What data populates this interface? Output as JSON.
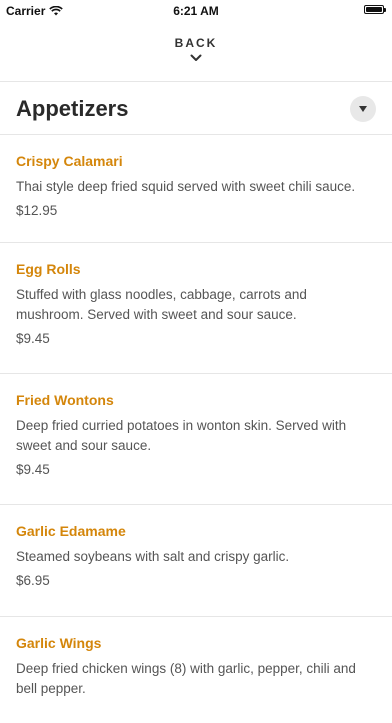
{
  "status_bar": {
    "carrier": "Carrier",
    "time": "6:21 AM",
    "wifi_icon": "wifi-icon",
    "battery_icon": "battery-icon"
  },
  "nav": {
    "back_label": "BACK",
    "chevron_icon": "chevron-down-icon"
  },
  "section": {
    "title": "Appetizers",
    "toggle_icon": "caret-down-icon"
  },
  "colors": {
    "item_name": "#d4860b",
    "text": "#555555",
    "divider": "#e6e6e6"
  },
  "items": [
    {
      "name": "Crispy Calamari",
      "description": "Thai style deep fried squid served with sweet chili sauce.",
      "price": "$12.95"
    },
    {
      "name": "Egg Rolls",
      "description": "Stuffed with glass noodles, cabbage, carrots and mushroom. Served with sweet and sour sauce.",
      "price": "$9.45"
    },
    {
      "name": "Fried Wontons",
      "description": "Deep fried curried potatoes in wonton skin. Served with sweet and sour sauce.",
      "price": "$9.45"
    },
    {
      "name": "Garlic Edamame",
      "description": "Steamed soybeans with salt and crispy garlic.",
      "price": "$6.95"
    },
    {
      "name": "Garlic Wings",
      "description": "Deep fried chicken wings (8) with garlic, pepper, chili and bell pepper.",
      "price": ""
    }
  ]
}
